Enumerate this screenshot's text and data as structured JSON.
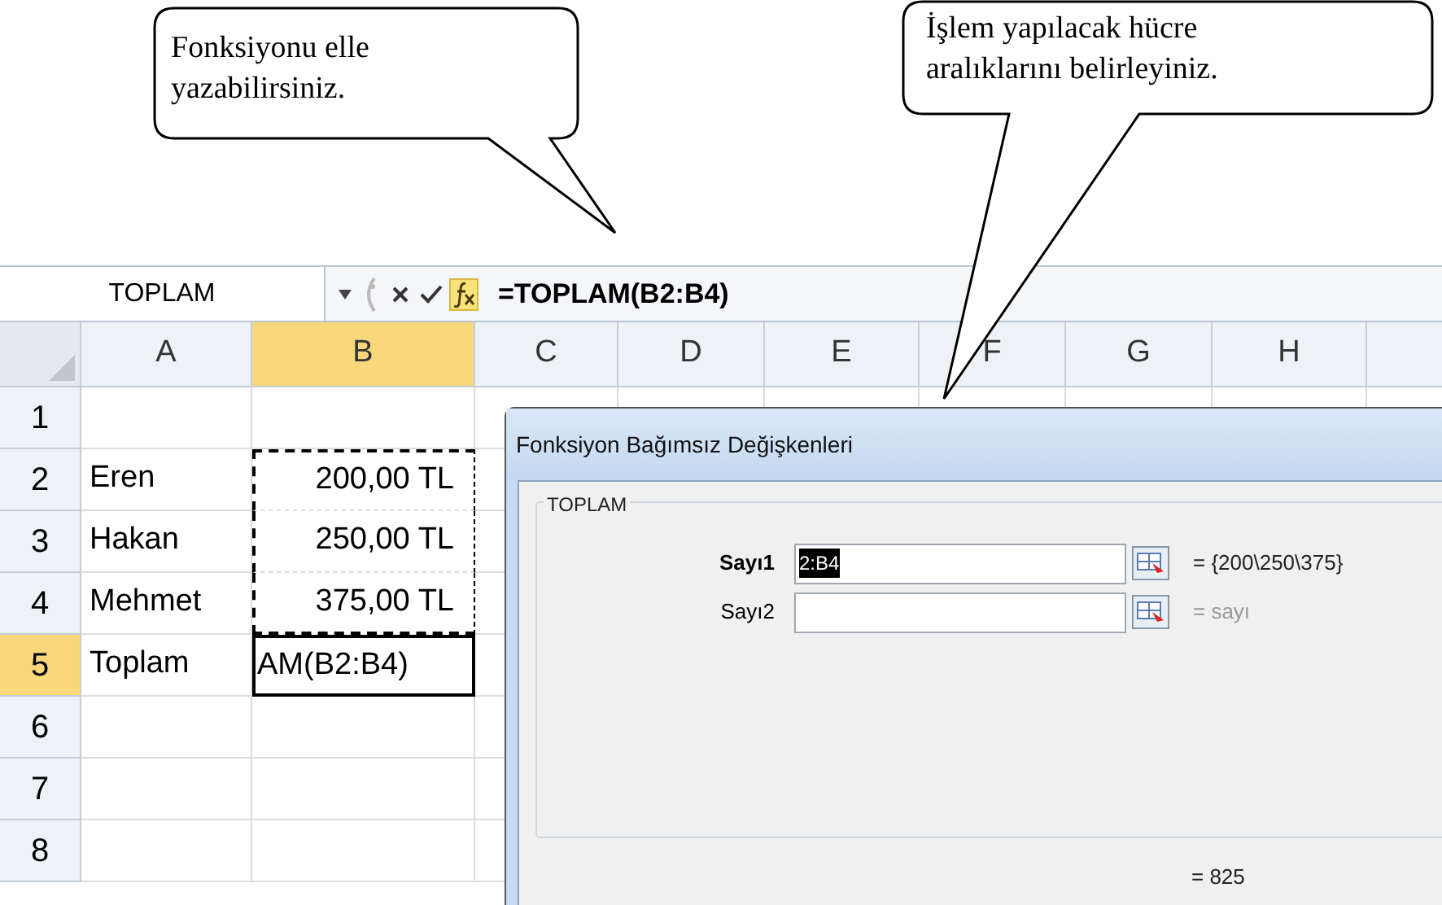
{
  "callouts": [
    {
      "lines": [
        "Fonksiyonu elle",
        "yazabilirsiniz."
      ]
    },
    {
      "lines": [
        "İşlem yapılacak hücre",
        "aralıklarını belirleyiniz."
      ]
    }
  ],
  "formula_bar": {
    "name_box": "TOPLAM",
    "formula": "=TOPLAM(B2:B4)"
  },
  "columns": [
    {
      "label": "A",
      "selected": false
    },
    {
      "label": "B",
      "selected": true
    },
    {
      "label": "C",
      "selected": false
    },
    {
      "label": "D",
      "selected": false
    },
    {
      "label": "E",
      "selected": false
    },
    {
      "label": "F",
      "selected": false
    },
    {
      "label": "G",
      "selected": false
    },
    {
      "label": "H",
      "selected": false
    }
  ],
  "rows": [
    {
      "label": "1",
      "selected": false
    },
    {
      "label": "2",
      "selected": false,
      "column_a": "Eren",
      "column_b": "200,00 TL",
      "in_range": true
    },
    {
      "label": "3",
      "selected": false,
      "column_a": "Hakan",
      "column_b": "250,00 TL",
      "in_range": true
    },
    {
      "label": "4",
      "selected": false,
      "column_a": "Mehmet",
      "column_b": "375,00 TL",
      "in_range": true
    },
    {
      "label": "5",
      "selected": true,
      "column_a": "Toplam",
      "column_b": "AM(B2:B4)",
      "in_range": false
    },
    {
      "label": "6",
      "selected": false
    },
    {
      "label": "7",
      "selected": false
    },
    {
      "label": "8",
      "selected": false
    }
  ],
  "dialog": {
    "title": "Fonksiyon Bağımsız Değişkenleri",
    "group": "TOPLAM",
    "arguments": [
      {
        "label": "Sayı1",
        "active": true,
        "value": "2:B4",
        "value_selected": true,
        "result": "= {200\\250\\375}"
      },
      {
        "label": "Sayı2",
        "active": false,
        "result": "= sayı"
      }
    ],
    "total": "= 825"
  }
}
